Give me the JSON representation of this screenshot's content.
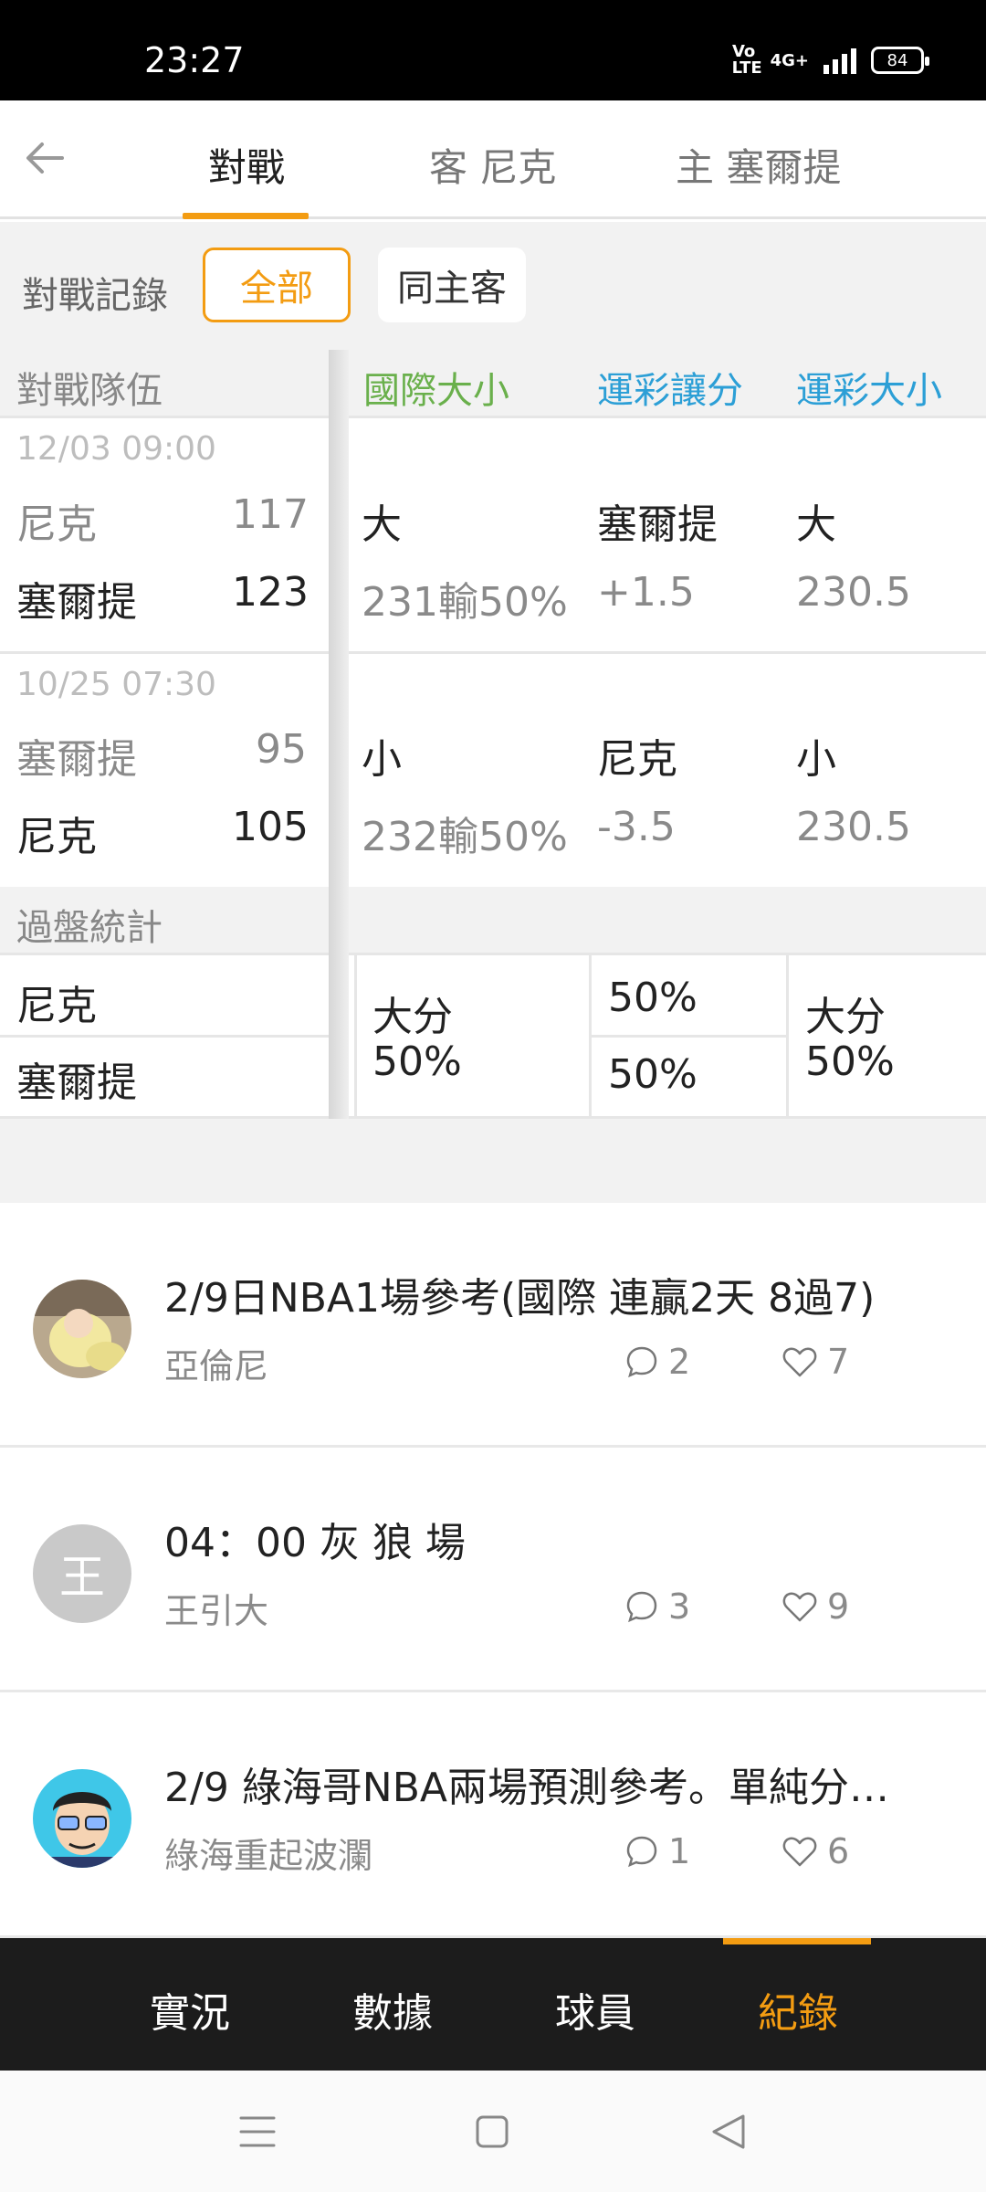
{
  "status_bar": {
    "time": "23:27",
    "volte": "Vo LTE",
    "network": "4G+",
    "battery": "84"
  },
  "top_nav": {
    "tabs": [
      {
        "label": "對戰",
        "active": true
      },
      {
        "label": "客 尼克",
        "active": false
      },
      {
        "label": "主 塞爾提",
        "active": false
      }
    ]
  },
  "filter": {
    "label": "對戰記錄",
    "options": [
      {
        "label": "全部",
        "selected": true
      },
      {
        "label": "同主客",
        "selected": false
      }
    ]
  },
  "table": {
    "header": {
      "team_col": "對戰隊伍",
      "col1": "國際大小",
      "col2": "運彩讓分",
      "col3": "運彩大小"
    },
    "games": [
      {
        "date": "12/03 09:00",
        "away_team": "尼克",
        "away_score": "117",
        "home_team": "塞爾提",
        "home_score": "123",
        "intl_result": "大",
        "intl_line": "231輸50%",
        "spread_team": "塞爾提",
        "spread_line": "+1.5",
        "ou_result": "大",
        "ou_line": "230.5"
      },
      {
        "date": "10/25 07:30",
        "away_team": "塞爾提",
        "away_score": "95",
        "home_team": "尼克",
        "home_score": "105",
        "intl_result": "小",
        "intl_line": "232輸50%",
        "spread_team": "尼克",
        "spread_line": "-3.5",
        "ou_result": "小",
        "ou_line": "230.5"
      }
    ],
    "summary": {
      "label": "過盤統計",
      "team1": "尼克",
      "team2": "塞爾提",
      "intl_label": "大分",
      "intl_pct": "50%",
      "spread_team1_pct": "50%",
      "spread_team2_pct": "50%",
      "ou_label": "大分",
      "ou_pct": "50%"
    }
  },
  "posts": [
    {
      "title": "2/9日NBA1場參考(國際 連贏2天 8過7)",
      "author": "亞倫尼",
      "comments": "2",
      "likes": "7"
    },
    {
      "title": "04：00 灰 狼 場",
      "author": "王引大",
      "avatar_initial": "王",
      "comments": "3",
      "likes": "9"
    },
    {
      "title": "2/9 綠海哥NBA兩場預測參考。單純分…",
      "author": "綠海重起波瀾",
      "comments": "1",
      "likes": "6"
    }
  ],
  "bottom_nav": {
    "items": [
      {
        "label": "實況",
        "active": false
      },
      {
        "label": "數據",
        "active": false
      },
      {
        "label": "球員",
        "active": false
      },
      {
        "label": "紀錄",
        "active": true
      }
    ]
  },
  "colors": {
    "accent": "#f39c12",
    "green_header": "#6ab04c",
    "blue_header": "#2c9fd6",
    "win_green": "#23a336"
  }
}
